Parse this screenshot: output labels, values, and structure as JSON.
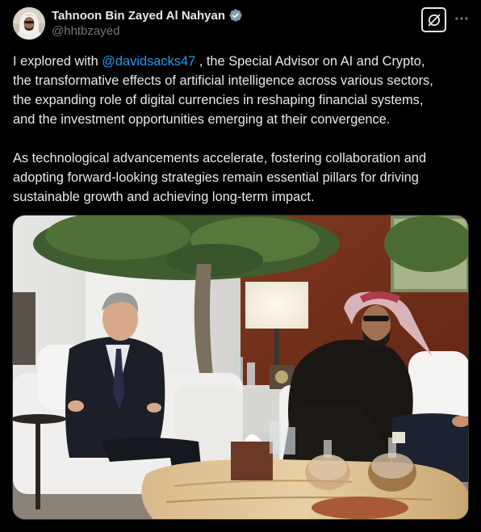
{
  "author": {
    "display_name": "Tahnoon Bin Zayed Al Nahyan",
    "handle": "@hhtbzayed",
    "verified": true,
    "avatar_icon": "avatar-portrait"
  },
  "actions": {
    "grok_icon": "grok-icon",
    "more_icon": "more-options-icon"
  },
  "tweet": {
    "para1_prefix": "I explored with ",
    "mention": "@davidsacks47",
    "para1_line1_rest": " , the Special Advisor on AI and Crypto,",
    "para1_line2": "the transformative effects of artificial intelligence across various sectors,",
    "para1_line3": "the expanding role of digital currencies in reshaping financial systems,",
    "para1_line4": "and the investment opportunities emerging at their convergence.",
    "para2_line1": "As technological advancements accelerate, fostering collaboration and",
    "para2_line2": "adopting forward-looking strategies remain essential pillars for driving",
    "para2_line3": "sustainable growth and achieving long-term impact."
  },
  "media": {
    "kind": "photo",
    "scene": "meeting-photo"
  },
  "colors": {
    "background": "#000000",
    "text": "#e7e9ea",
    "secondary_text": "#71767b",
    "link": "#1d9bf0",
    "verified_badge": "#829aab"
  }
}
